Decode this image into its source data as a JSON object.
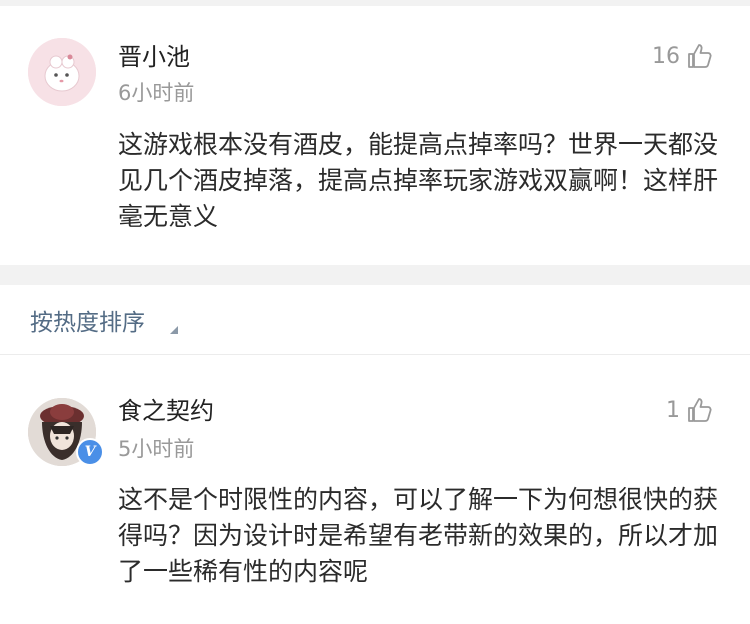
{
  "comments": [
    {
      "username": "晋小池",
      "time": "6小时前",
      "likes": "16",
      "text": "这游戏根本没有酒皮，能提高点掉率吗？世界一天都没见几个酒皮掉落，提高点掉率玩家游戏双赢啊！这样肝毫无意义",
      "avatar_icon": "pink-cartoon-avatar"
    },
    {
      "username": "食之契约",
      "time": "5小时前",
      "likes": "1",
      "text": "这不是个时限性的内容，可以了解一下为何想很快的获得吗？因为设计时是希望有老带新的效果的，所以才加了一些稀有性的内容呢",
      "avatar_icon": "anime-character-avatar",
      "verified": true
    }
  ],
  "sort": {
    "label": "按热度排序"
  },
  "colors": {
    "link": "#546c85",
    "muted": "#999999",
    "separator": "#f2f2f2",
    "verified": "#4a8fe7"
  }
}
